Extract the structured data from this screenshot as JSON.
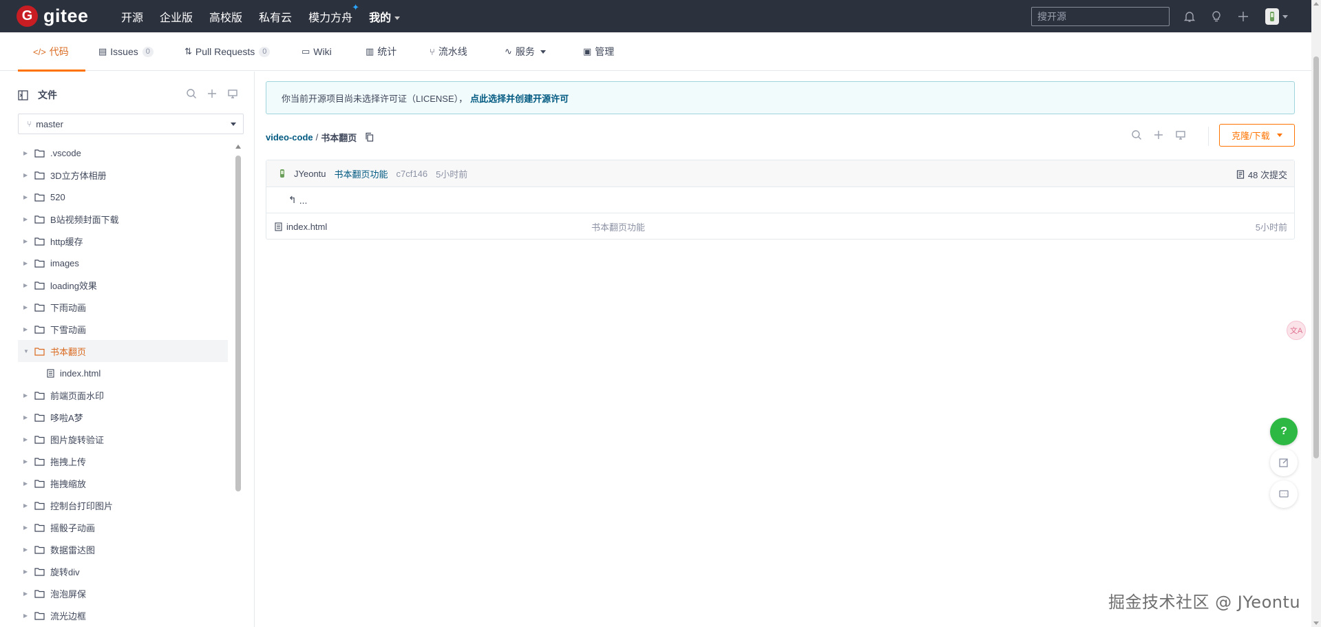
{
  "topbar": {
    "logo_mark": "G",
    "logo_text": "gitee",
    "nav": [
      "开源",
      "企业版",
      "高校版",
      "私有云",
      "模力方舟",
      "我的"
    ],
    "search_placeholder": "搜开源"
  },
  "tabs": [
    {
      "label": "代码",
      "icon": "code-icon"
    },
    {
      "label": "Issues",
      "badge": "0",
      "icon": "issues-icon"
    },
    {
      "label": "Pull Requests",
      "badge": "0",
      "icon": "pull-request-icon"
    },
    {
      "label": "Wiki",
      "icon": "wiki-icon"
    },
    {
      "label": "统计",
      "icon": "chart-icon"
    },
    {
      "label": "流水线",
      "icon": "pipeline-icon"
    },
    {
      "label": "服务",
      "icon": "service-icon"
    },
    {
      "label": "管理",
      "icon": "manage-icon"
    }
  ],
  "sidebar": {
    "title": "文件",
    "branch": "master",
    "tree": [
      {
        "label": ".vscode",
        "expanded": false
      },
      {
        "label": "3D立方体相册",
        "expanded": false
      },
      {
        "label": "520",
        "expanded": false
      },
      {
        "label": "B站视频封面下载",
        "expanded": false
      },
      {
        "label": "http缓存",
        "expanded": false
      },
      {
        "label": "images",
        "expanded": false
      },
      {
        "label": "loading效果",
        "expanded": false
      },
      {
        "label": "下雨动画",
        "expanded": false
      },
      {
        "label": "下雪动画",
        "expanded": false
      },
      {
        "label": "书本翻页",
        "expanded": true
      },
      {
        "label": "index.html",
        "file": true
      },
      {
        "label": "前端页面水印",
        "expanded": false
      },
      {
        "label": "哆啦A梦",
        "expanded": false
      },
      {
        "label": "图片旋转验证",
        "expanded": false
      },
      {
        "label": "拖拽上传",
        "expanded": false
      },
      {
        "label": "拖拽缩放",
        "expanded": false
      },
      {
        "label": "控制台打印图片",
        "expanded": false
      },
      {
        "label": "摇骰子动画",
        "expanded": false
      },
      {
        "label": "数据雷达图",
        "expanded": false
      },
      {
        "label": "旋转div",
        "expanded": false
      },
      {
        "label": "泡泡屏保",
        "expanded": false
      },
      {
        "label": "流光边框",
        "expanded": false
      }
    ]
  },
  "main": {
    "license_text": "你当前开源项目尚未选择许可证（LICENSE），",
    "license_link": "点此选择并创建开源许可",
    "breadcrumb_repo": "video-code",
    "breadcrumb_sep": "/",
    "breadcrumb_current": "书本翻页",
    "clone_label": "克隆/下载",
    "commit": {
      "author": "JYeontu",
      "message": "书本翻页功能",
      "sha": "c7cf146",
      "time": "5小时前",
      "count": "48 次提交"
    },
    "back_label": "...",
    "files": [
      {
        "name": "index.html",
        "message": "书本翻页功能",
        "time": "5小时前"
      }
    ]
  },
  "floating": {
    "help": "?",
    "translate": "文A"
  },
  "watermark": "掘金技术社区 @ JYeontu",
  "colors": {
    "topbar_bg": "#2c313e",
    "brand_red": "#c71d23",
    "accent_orange": "#fe7300",
    "link_blue": "#005980",
    "help_green": "#2cb843"
  }
}
